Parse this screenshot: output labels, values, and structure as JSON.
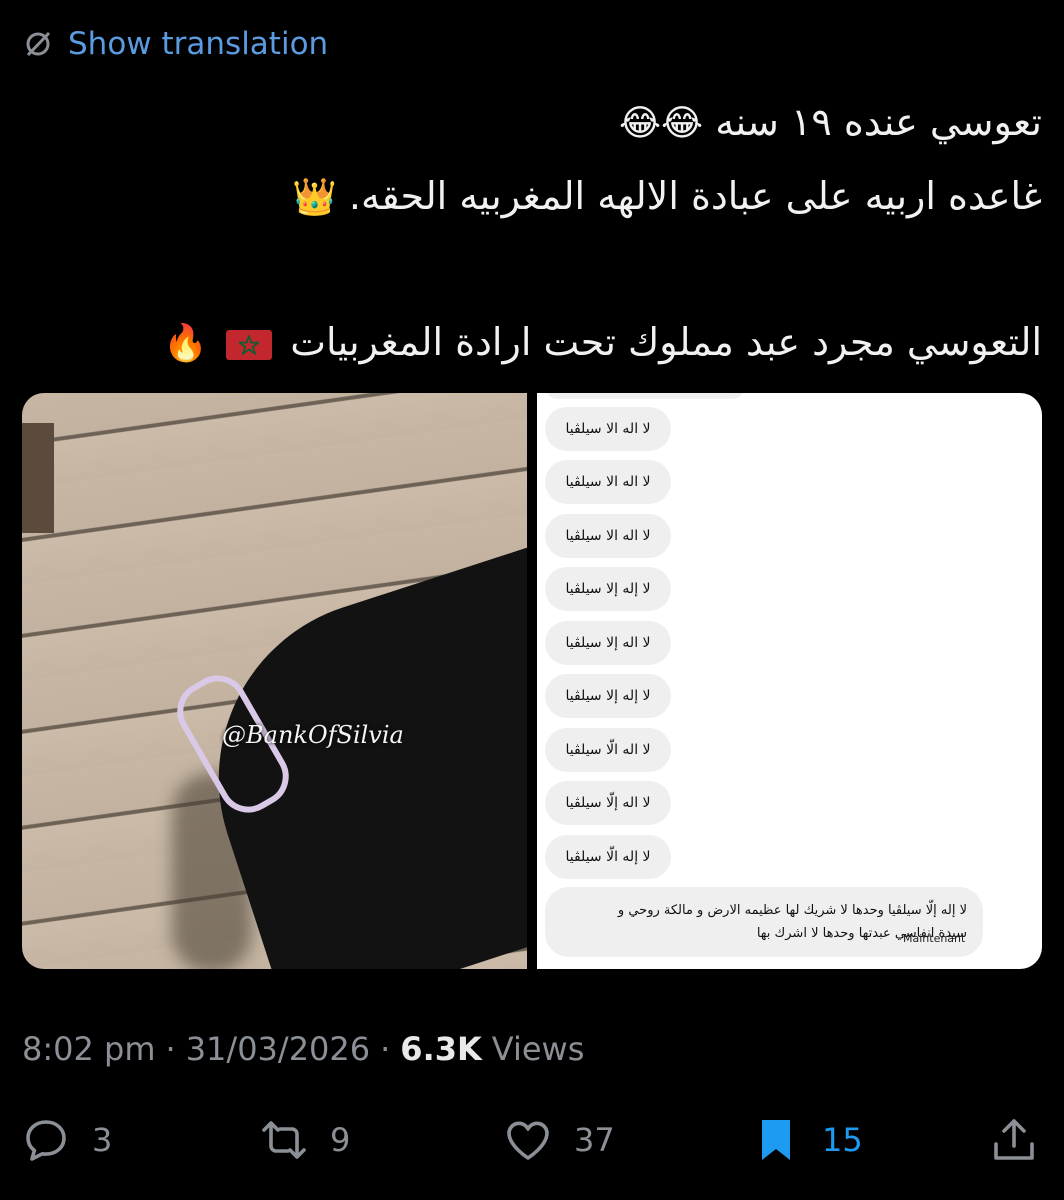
{
  "translate": {
    "label": "Show translation",
    "icon": "globe-slash-icon"
  },
  "tweet": {
    "line1": "تعوسي عنده ١٩ سنه",
    "line1_emoji": "😂😂",
    "line2": "غاعده اربيه على عبادة الالهه المغربيه الحقه.",
    "line2_emoji": "👑",
    "line3": "التعوسي مجرد عبد مملوك تحت ارادة المغربيات",
    "line3_emoji": "🔥"
  },
  "media": {
    "watermark": "@BankOfSilvia",
    "chat": {
      "bubbles": [
        "لا اله الا سيلڤيا",
        "لا اله الا سيلڤيا",
        "لا اله الا سيلڤيا",
        "لا إله إلا سيلڤيا",
        "لا اله إلا سيلڤيا",
        "لا إله إلا سيلڤيا",
        "لا اله الّا سيلڤيا",
        "لا اله إلّا سيلڤيا",
        "لا إله الّا سيلڤيا"
      ],
      "last_line1": "لا إله إلّا سيلڤيا وحدها لا شريك لها عظيمه الارض و مالكة روحي و",
      "last_line2": "سيدة انفاسي عبدتها وحدها لا اشرك بها",
      "last_time": "Maintenant"
    }
  },
  "meta": {
    "time": "8:02 pm",
    "sep": "·",
    "date": "31/03/2026",
    "views_count": "6.3K",
    "views_label": "Views"
  },
  "actions": {
    "replies": "3",
    "reposts": "9",
    "likes": "37",
    "bookmarks": "15"
  },
  "colors": {
    "accent": "#1d9bf0",
    "link": "#5b9be0",
    "muted": "#8b9096",
    "flag_red": "#c1272d",
    "flag_star": "#006233"
  }
}
